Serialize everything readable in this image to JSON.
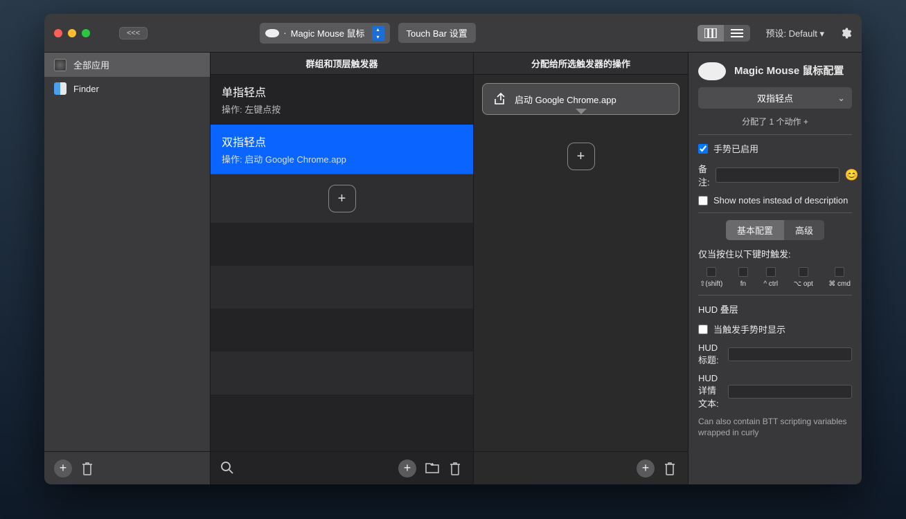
{
  "toolbar": {
    "back_label": "<<<",
    "device_dot": "·",
    "device_label": "Magic Mouse 鼠标",
    "touchbar_label": "Touch Bar 设置",
    "preset_label": "预设: Default ▾"
  },
  "sidebar": {
    "items": [
      {
        "label": "全部应用"
      },
      {
        "label": "Finder"
      }
    ]
  },
  "triggers": {
    "header": "群组和顶层触发器",
    "items": [
      {
        "title": "单指轻点",
        "sub": "操作: 左键点按"
      },
      {
        "title": "双指轻点",
        "sub": "操作: 启动 Google Chrome.app"
      }
    ]
  },
  "actions": {
    "header": "分配给所选触发器的操作",
    "items": [
      {
        "label": "启动 Google Chrome.app"
      }
    ]
  },
  "inspector": {
    "title": "Magic Mouse 鼠标配置",
    "gesture_dropdown": "双指轻点",
    "assigned_line": "分配了 1 个动作 +",
    "gesture_enabled_label": "手势已启用",
    "notes_label": "备注:",
    "show_notes_label": "Show notes instead of description",
    "tab_basic": "基本配置",
    "tab_advanced": "高级",
    "modifier_header": "仅当按住以下键时触发:",
    "modifiers": [
      "⇧(shift)",
      "fn",
      "^ ctrl",
      "⌥ opt",
      "⌘ cmd"
    ],
    "hud_header": "HUD 叠层",
    "hud_show_label": "当触发手势时显示",
    "hud_title_label": "HUD 标题:",
    "hud_detail_label": "HUD 详情文本:",
    "hint": "Can also contain BTT scripting variables wrapped in curly"
  }
}
